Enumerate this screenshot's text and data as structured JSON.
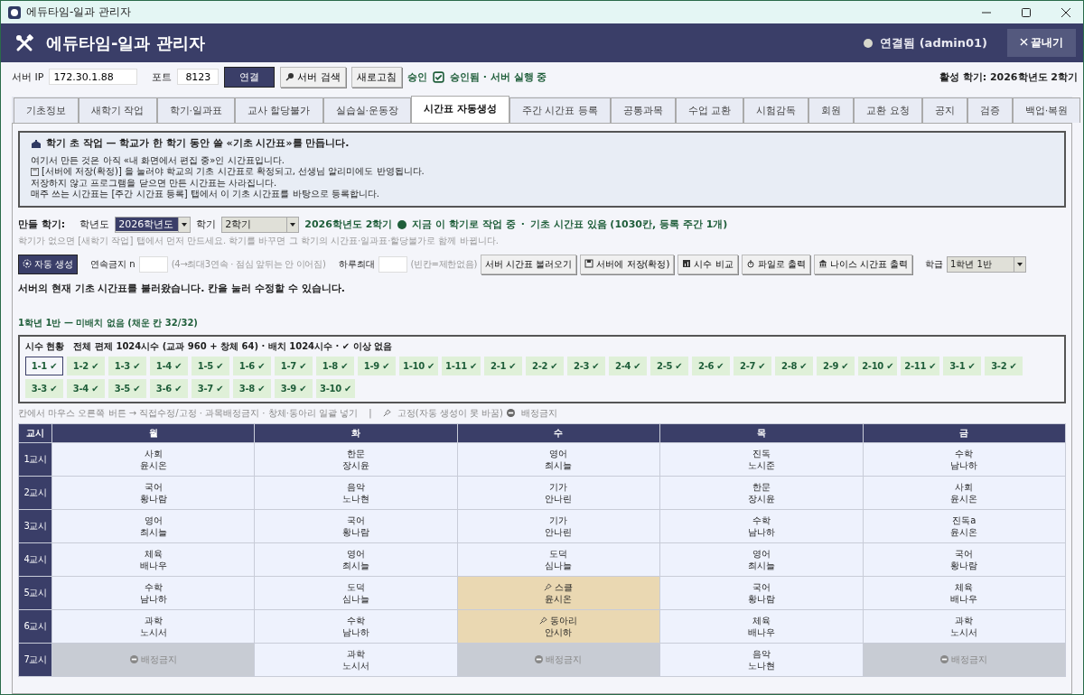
{
  "window": {
    "title": "에듀타임-일과 관리자"
  },
  "header": {
    "title": "에듀타임-일과 관리자",
    "status": "연결됨 (admin01)",
    "quit_button": "끝내기"
  },
  "server": {
    "ip_label": "서버 IP",
    "ip_value": "172.30.1.88",
    "port_label": "포트",
    "port_value": "8123",
    "connect_button": "연결",
    "search_button": "서버 검색",
    "refresh_button": "새로고침",
    "approval_label": "승인",
    "approval_checked": true,
    "approval_text": "승인됨 · 서버 실행 중",
    "active_term": "활성 학기: 2026학년도 2학기"
  },
  "tabs": [
    {
      "label": "기초정보",
      "selected": false
    },
    {
      "label": "새학기 작업",
      "selected": false
    },
    {
      "label": "학기·일과표",
      "selected": false
    },
    {
      "label": "교사 할당불가",
      "selected": false
    },
    {
      "label": "실습실·운동장",
      "selected": false
    },
    {
      "label": "시간표 자동생성",
      "selected": true
    },
    {
      "label": "주간 시간표 등록",
      "selected": false
    },
    {
      "label": "공통과목",
      "selected": false
    },
    {
      "label": "수업 교환",
      "selected": false
    },
    {
      "label": "시험감독",
      "selected": false
    },
    {
      "label": "회원",
      "selected": false
    },
    {
      "label": "교환 요청",
      "selected": false
    },
    {
      "label": "공지",
      "selected": false
    },
    {
      "label": "검증",
      "selected": false
    },
    {
      "label": "백업·복원",
      "selected": false
    }
  ],
  "info": {
    "title": "학기 초 작업 — 학교가 한 학기 동안 쓸 «기초 시간표»를 만듭니다.",
    "lines": [
      "여기서 만든 것은 아직 «내 화면에서 편집 중»인 시간표입니다.",
      "[서버에 저장(확정)] 을 눌러야 학교의 기초 시간표로 확정되고, 선생님 알리미에도 반영됩니다.",
      "저장하지 않고 프로그램을 닫으면 만든 시간표는 사라집니다.",
      "매주 쓰는 시간표는 [주간 시간표 등록] 탭에서 이 기초 시간표를 바탕으로 등록합니다."
    ]
  },
  "term": {
    "label": "만들 학기:",
    "year_label": "학년도",
    "year_value": "2026학년도",
    "term_label": "학기",
    "term_value": "2학기",
    "term_name": "2026학년도 2학기",
    "working_text": "지금 이 학기로 작업 중",
    "separator": "·",
    "base_text": "기초 시간표 있음 (1030칸, 등록 주간 1개)",
    "hint": "학기가 없으면 [새학기 작업] 탭에서 먼저 만드세요. 학기를 바꾸면 그 학기의 시간표·일과표·할당불가로 함께 바뀝니다."
  },
  "toolbar": {
    "auto_button": "자동 생성",
    "consec_label": "연속금지 n",
    "consec_hint": "(4→최대3연속 · 점심 앞뒤는 안 이어짐)",
    "daily_label": "하루최대",
    "daily_hint": "(빈칸=제한없음)",
    "buttons": [
      {
        "kind": "plain",
        "label": "서버 시간표 불러오기"
      },
      {
        "kind": "save",
        "label": "서버에 저장(확정)"
      },
      {
        "kind": "chart",
        "label": "시수 비교"
      },
      {
        "kind": "export",
        "label": "파일로 출력"
      },
      {
        "kind": "bank",
        "label": "나이스 시간표 출력"
      }
    ],
    "class_label": "학급",
    "class_value": "1학년 1반"
  },
  "message": "서버의 현재 기초 시간표를 불러왔습니다. 칸을 눌러 수정할 수 있습니다.",
  "class_status": "1학년 1반 — 미배치 없음 (채운 칸 32/32)",
  "hours": {
    "title": "시수 현황",
    "summary": "전체 편제 1024시수 (교과 960 + 창체 64)  ·  배치 1024시수  ·  ✔ 이상 없음",
    "chips": [
      {
        "label": "1-1 ✔",
        "selected": true
      },
      {
        "label": "1-2 ✔",
        "selected": false
      },
      {
        "label": "1-3 ✔",
        "selected": false
      },
      {
        "label": "1-4 ✔",
        "selected": false
      },
      {
        "label": "1-5 ✔",
        "selected": false
      },
      {
        "label": "1-6 ✔",
        "selected": false
      },
      {
        "label": "1-7 ✔",
        "selected": false
      },
      {
        "label": "1-8 ✔",
        "selected": false
      },
      {
        "label": "1-9 ✔",
        "selected": false
      },
      {
        "label": "1-10 ✔",
        "selected": false
      },
      {
        "label": "1-11 ✔",
        "selected": false
      },
      {
        "label": "2-1 ✔",
        "selected": false
      },
      {
        "label": "2-2 ✔",
        "selected": false
      },
      {
        "label": "2-3 ✔",
        "selected": false
      },
      {
        "label": "2-4 ✔",
        "selected": false
      },
      {
        "label": "2-5 ✔",
        "selected": false
      },
      {
        "label": "2-6 ✔",
        "selected": false
      },
      {
        "label": "2-7 ✔",
        "selected": false
      },
      {
        "label": "2-8 ✔",
        "selected": false
      },
      {
        "label": "2-9 ✔",
        "selected": false
      },
      {
        "label": "2-10 ✔",
        "selected": false
      },
      {
        "label": "2-11 ✔",
        "selected": false
      },
      {
        "label": "3-1 ✔",
        "selected": false
      },
      {
        "label": "3-2 ✔",
        "selected": false
      },
      {
        "label": "3-3 ✔",
        "selected": false
      },
      {
        "label": "3-4 ✔",
        "selected": false
      },
      {
        "label": "3-5 ✔",
        "selected": false
      },
      {
        "label": "3-6 ✔",
        "selected": false
      },
      {
        "label": "3-7 ✔",
        "selected": false
      },
      {
        "label": "3-8 ✔",
        "selected": false
      },
      {
        "label": "3-9 ✔",
        "selected": false
      },
      {
        "label": "3-10 ✔",
        "selected": false
      }
    ]
  },
  "legend": {
    "divider": "|",
    "text": "칸에서 마우스 오른쪽 버튼 → 직접수정/고정 · 과목배정금지 · 창체·동아리 일괄 넣기",
    "pinned": "고정(자동 생성이 못 바꿈)",
    "blocked": "배정금지"
  },
  "timetable": {
    "corner": "교시",
    "days": [
      "월",
      "화",
      "수",
      "목",
      "금"
    ],
    "rows": [
      {
        "period": "1교시",
        "cells": [
          {
            "kind": "normal",
            "subject": "사회",
            "teacher": "윤시온"
          },
          {
            "kind": "normal",
            "subject": "한문",
            "teacher": "장시윤"
          },
          {
            "kind": "normal",
            "subject": "영어",
            "teacher": "최시늘"
          },
          {
            "kind": "normal",
            "subject": "진독",
            "teacher": "노시준"
          },
          {
            "kind": "normal",
            "subject": "수학",
            "teacher": "남나하"
          }
        ]
      },
      {
        "period": "2교시",
        "cells": [
          {
            "kind": "normal",
            "subject": "국어",
            "teacher": "황나람"
          },
          {
            "kind": "normal",
            "subject": "음악",
            "teacher": "노나현"
          },
          {
            "kind": "normal",
            "subject": "기가",
            "teacher": "안나린"
          },
          {
            "kind": "normal",
            "subject": "한문",
            "teacher": "장시윤"
          },
          {
            "kind": "normal",
            "subject": "사회",
            "teacher": "윤시온"
          }
        ]
      },
      {
        "period": "3교시",
        "cells": [
          {
            "kind": "normal",
            "subject": "영어",
            "teacher": "최시늘"
          },
          {
            "kind": "normal",
            "subject": "국어",
            "teacher": "황나람"
          },
          {
            "kind": "normal",
            "subject": "기가",
            "teacher": "안나린"
          },
          {
            "kind": "normal",
            "subject": "수학",
            "teacher": "남나하"
          },
          {
            "kind": "normal",
            "subject": "진독a",
            "teacher": "윤시온"
          }
        ]
      },
      {
        "period": "4교시",
        "cells": [
          {
            "kind": "normal",
            "subject": "체육",
            "teacher": "배나우"
          },
          {
            "kind": "normal",
            "subject": "영어",
            "teacher": "최시늘"
          },
          {
            "kind": "normal",
            "subject": "도덕",
            "teacher": "심나늘"
          },
          {
            "kind": "normal",
            "subject": "영어",
            "teacher": "최시늘"
          },
          {
            "kind": "normal",
            "subject": "국어",
            "teacher": "황나람"
          }
        ]
      },
      {
        "period": "5교시",
        "cells": [
          {
            "kind": "normal",
            "subject": "수학",
            "teacher": "남나하"
          },
          {
            "kind": "normal",
            "subject": "도덕",
            "teacher": "심나늘"
          },
          {
            "kind": "pinned",
            "subject": "스클",
            "teacher": "윤시온"
          },
          {
            "kind": "normal",
            "subject": "국어",
            "teacher": "황나람"
          },
          {
            "kind": "normal",
            "subject": "체육",
            "teacher": "배나우"
          }
        ]
      },
      {
        "period": "6교시",
        "cells": [
          {
            "kind": "normal",
            "subject": "과학",
            "teacher": "노시서"
          },
          {
            "kind": "normal",
            "subject": "수학",
            "teacher": "남나하"
          },
          {
            "kind": "pinned",
            "subject": "동아리",
            "teacher": "안시하"
          },
          {
            "kind": "normal",
            "subject": "체육",
            "teacher": "배나우"
          },
          {
            "kind": "normal",
            "subject": "과학",
            "teacher": "노시서"
          }
        ]
      },
      {
        "period": "7교시",
        "cells": [
          {
            "kind": "blocked",
            "subject": "배정금지"
          },
          {
            "kind": "normal",
            "subject": "과학",
            "teacher": "노시서"
          },
          {
            "kind": "blocked",
            "subject": "배정금지"
          },
          {
            "kind": "normal",
            "subject": "음악",
            "teacher": "노나현"
          },
          {
            "kind": "blocked",
            "subject": "배정금지"
          }
        ]
      }
    ]
  }
}
